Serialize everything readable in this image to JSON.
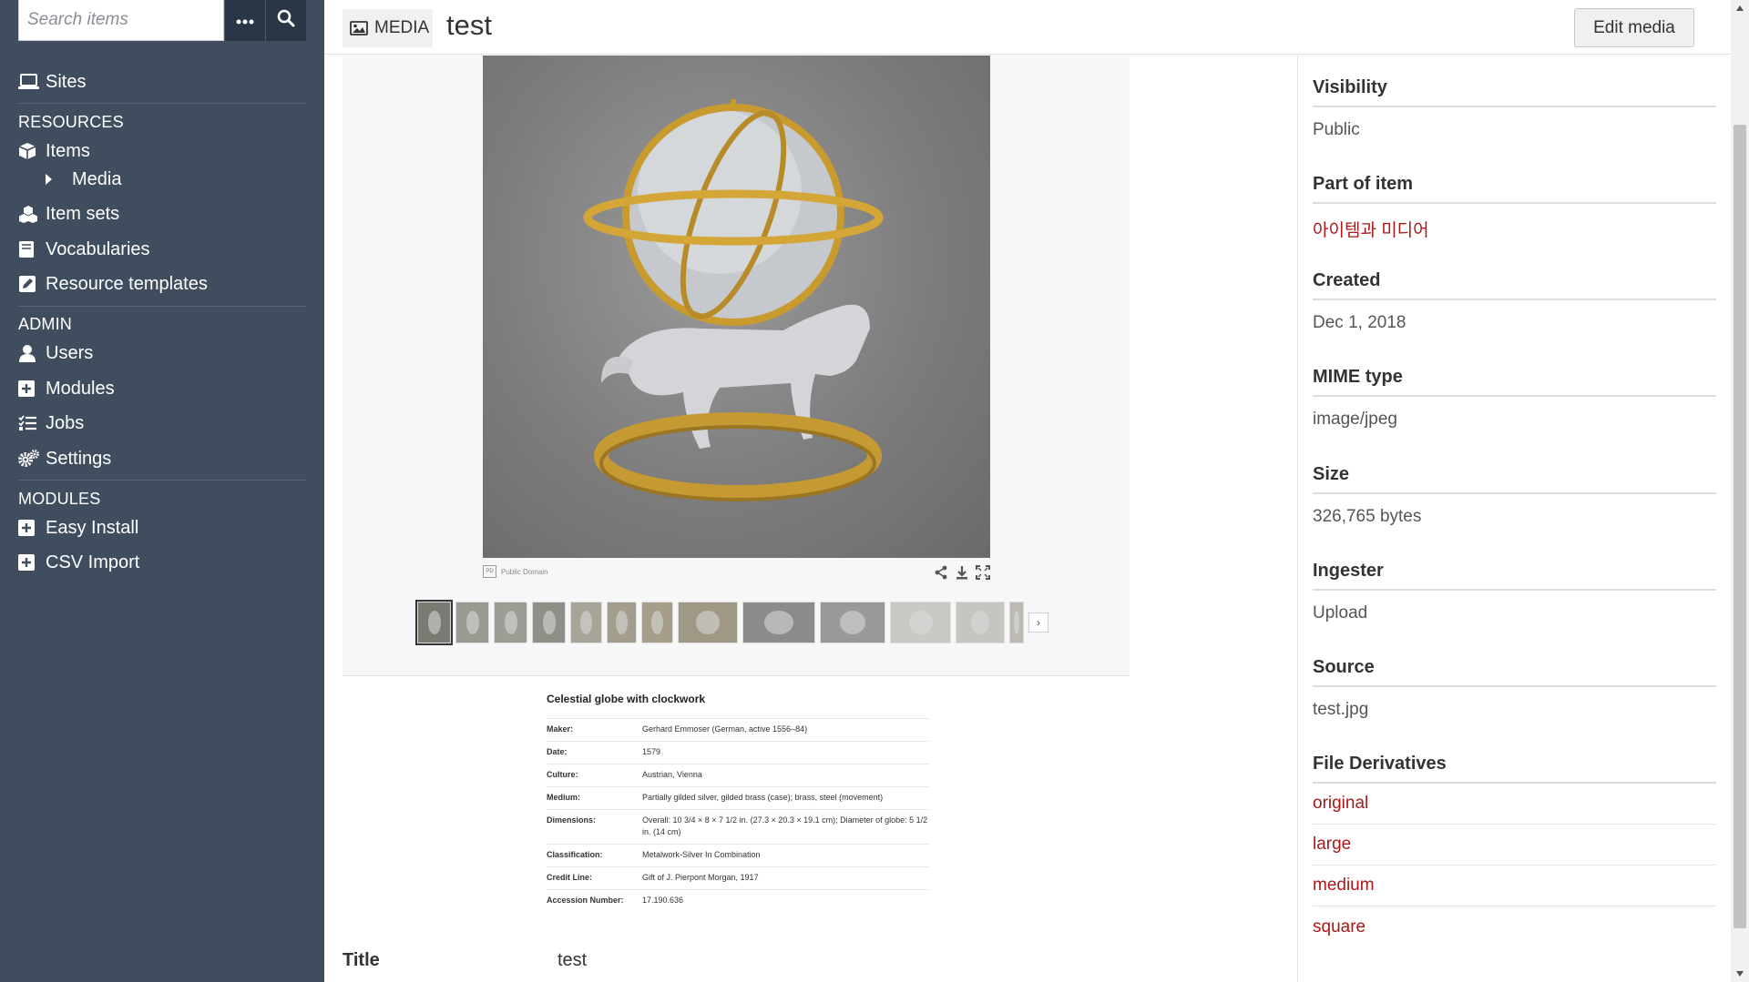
{
  "search": {
    "placeholder": "Search items"
  },
  "sidebar": {
    "sites_label": "Sites",
    "sections": {
      "resources": "RESOURCES",
      "admin": "ADMIN",
      "modules": "MODULES"
    },
    "resources": {
      "items": "Items",
      "media": "Media",
      "item_sets": "Item sets",
      "vocabularies": "Vocabularies",
      "resource_templates": "Resource templates"
    },
    "admin": {
      "users": "Users",
      "modules": "Modules",
      "jobs": "Jobs",
      "settings": "Settings"
    },
    "modules": {
      "easy_install": "Easy Install",
      "csv_import": "CSV Import"
    }
  },
  "header": {
    "badge": "MEDIA",
    "title": "test",
    "edit_button": "Edit media"
  },
  "viewer": {
    "rights": "Public Domain",
    "rights_badge": "PD",
    "next_arrow": "›",
    "thumbnail_count": 13
  },
  "info_card": {
    "title": "Celestial globe with clockwork",
    "rows": [
      {
        "label": "Maker:",
        "value": "Gerhard Emmoser (German, active 1556–84)"
      },
      {
        "label": "Date:",
        "value": "1579"
      },
      {
        "label": "Culture:",
        "value": "Austrian, Vienna"
      },
      {
        "label": "Medium:",
        "value": "Partially gilded silver, gilded brass (case); brass, steel (movement)"
      },
      {
        "label": "Dimensions:",
        "value": "Overall: 10 3/4 × 8 × 7 1/2 in. (27.3 × 20.3 × 19.1 cm); Diameter of globe: 5 1/2 in. (14 cm)"
      },
      {
        "label": "Classification:",
        "value": "Metalwork-Silver In Combination"
      },
      {
        "label": "Credit Line:",
        "value": "Gift of J. Pierpont Morgan, 1917"
      },
      {
        "label": "Accession Number:",
        "value": "17.190.636"
      }
    ]
  },
  "properties": {
    "title_label": "Title",
    "title_value": "test"
  },
  "side_panel": {
    "visibility_label": "Visibility",
    "visibility_value": "Public",
    "part_of_item_label": "Part of item",
    "part_of_item_value": "아이템과 미디어",
    "created_label": "Created",
    "created_value": "Dec 1, 2018",
    "mime_label": "MIME type",
    "mime_value": "image/jpeg",
    "size_label": "Size",
    "size_value": "326,765 bytes",
    "ingester_label": "Ingester",
    "ingester_value": "Upload",
    "source_label": "Source",
    "source_value": "test.jpg",
    "derivatives_label": "File Derivatives",
    "derivatives": [
      "original",
      "large",
      "medium",
      "square"
    ]
  },
  "colors": {
    "sidebar_bg": "#3f4d5e",
    "link": "#a91919"
  }
}
